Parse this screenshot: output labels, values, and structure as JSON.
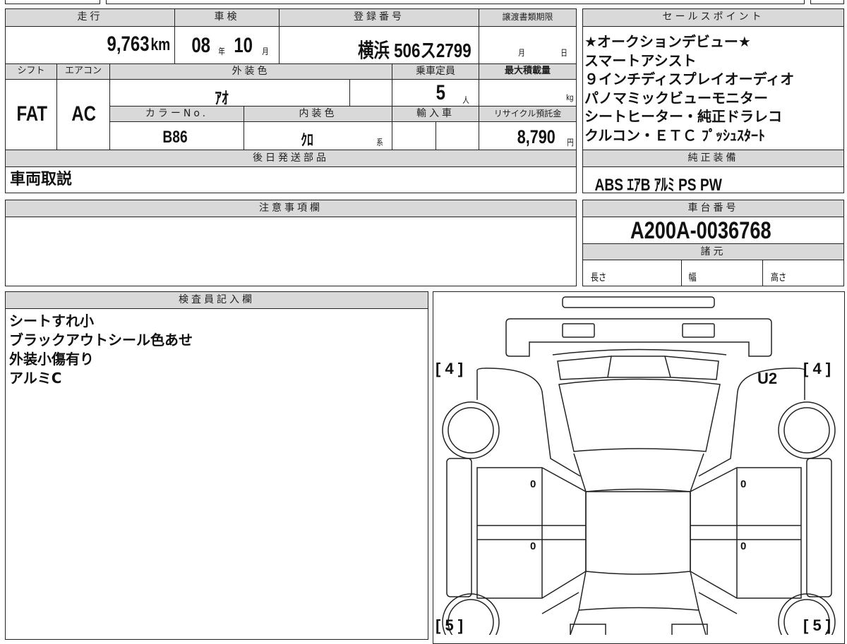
{
  "top_table": {
    "mileage": {
      "label": "走行",
      "value": "9,763",
      "unit": "km"
    },
    "inspection": {
      "label": "車検",
      "year": "08",
      "year_unit": "年",
      "month": "10",
      "month_unit": "月"
    },
    "registration": {
      "label": "登録番号",
      "value": "横浜 506ス2799"
    },
    "transfer_deadline": {
      "label": "譲渡書類期限",
      "month_unit": "月",
      "day_unit": "日"
    },
    "shift": {
      "label": "シフト",
      "value": "FAT"
    },
    "aircon": {
      "label": "エアコン",
      "value": "AC"
    },
    "exterior_color": {
      "label": "外装色",
      "value": "ｱｵ"
    },
    "capacity": {
      "label": "乗車定員",
      "value": "5",
      "unit": "人"
    },
    "max_load": {
      "label": "最大積載量",
      "unit": "kg"
    },
    "color_no": {
      "label": "カラーNo.",
      "value": "B86"
    },
    "interior_color": {
      "label": "内装色",
      "value": "ｸﾛ",
      "suffix": "系"
    },
    "import": {
      "label": "輸入車"
    },
    "recycle": {
      "label": "リサイクル預託金",
      "value": "8,790",
      "unit": "円"
    },
    "later_parts": {
      "label": "後日発送部品",
      "value": "車両取説"
    }
  },
  "sales_points": {
    "label": "セールスポイント",
    "lines": [
      "★オークションデビュー★",
      "スマートアシスト",
      "９インチディスプレイオーディオ",
      "パノマミックビューモニター",
      "シートヒーター・純正ドラレコ",
      "クルコン・ＥＴＣ ﾌﾟｯｼｭｽﾀｰﾄ"
    ]
  },
  "equipment": {
    "label": "純正装備",
    "value": "ABS ｴｱB ｱﾙﾐ PS PW"
  },
  "notes": {
    "label": "注意事項欄"
  },
  "chassis": {
    "label": "車台番号",
    "value": "A200A-0036768"
  },
  "specs": {
    "label": "諸元",
    "length": "長さ",
    "width": "幅",
    "height": "高さ"
  },
  "inspector": {
    "label": "検査員記入欄",
    "lines": [
      "シートすれ小",
      "ブラックアウトシール色あせ",
      "外装小傷有り",
      "アルミC"
    ]
  },
  "diagram": {
    "front_left": "[ 4 ]",
    "front_right": "[ 4 ]",
    "rear_left": "[ 5 ]",
    "rear_right": "[ 5 ]",
    "mark": "U2",
    "door_marks": [
      "0",
      "0",
      "0",
      "0"
    ]
  }
}
